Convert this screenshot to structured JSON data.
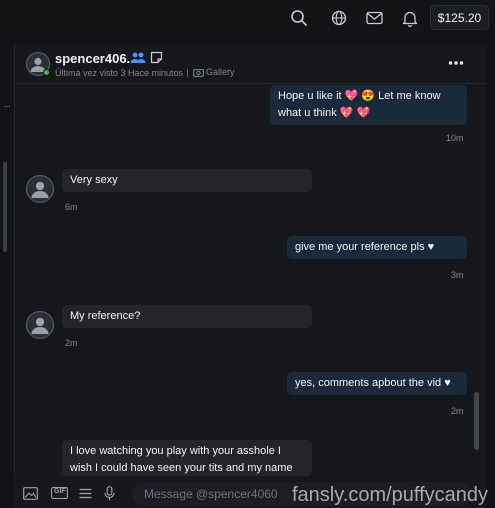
{
  "topbar": {
    "icons": [
      "search-icon",
      "globe-icon",
      "mail-icon",
      "bell-icon"
    ],
    "balance": "$125.20"
  },
  "chat_header": {
    "username": "spencer406...",
    "last_seen": "Última vez visto 3 Hace minutos",
    "gallery_label": "Gallery",
    "status": "online",
    "icons": [
      "users-icon",
      "note-icon",
      "more-icon"
    ]
  },
  "messages": [
    {
      "direction": "out",
      "text": "Hope u like it 💖 😍 Let me know what u think 💖 💖",
      "time": "10m"
    },
    {
      "direction": "in",
      "text": "Very sexy",
      "time": "6m"
    },
    {
      "direction": "out",
      "text": "give me your reference pls ♥",
      "time": "3m"
    },
    {
      "direction": "in",
      "text": "My reference?",
      "time": "2m"
    },
    {
      "direction": "out",
      "text": "yes, comments apbout the vid ♥",
      "time": "2m"
    },
    {
      "direction": "in",
      "text": "I love watching you play with your asshole I wish I could have seen your tits and my name on your",
      "time": ""
    }
  ],
  "composer": {
    "placeholder": "Message @spencer4060",
    "icons": [
      "image-icon",
      "gif-icon",
      "list-icon",
      "mic-icon"
    ],
    "gif_label": "GIF"
  },
  "watermark": "fansly.com/puffycandy",
  "colors": {
    "background": "#121416",
    "panel": "#16181b",
    "outgoing_bubble": "#1b2a3a",
    "incoming_bubble": "#232529",
    "online": "#4caf50"
  }
}
